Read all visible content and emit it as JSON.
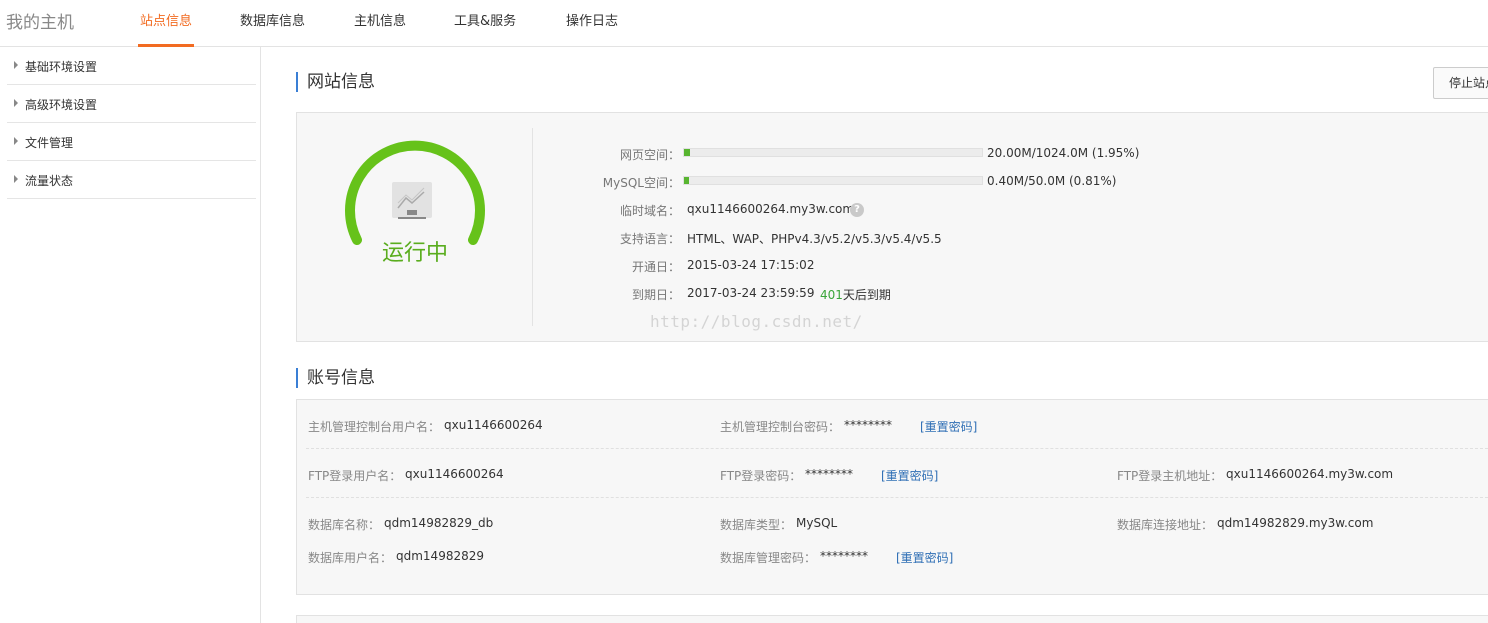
{
  "header": {
    "brand": "我的主机",
    "tabs": [
      {
        "label": "站点信息",
        "active": true
      },
      {
        "label": "数据库信息",
        "active": false
      },
      {
        "label": "主机信息",
        "active": false
      },
      {
        "label": "工具&服务",
        "active": false
      },
      {
        "label": "操作日志",
        "active": false
      }
    ]
  },
  "sidebar": {
    "items": [
      {
        "label": "基础环境设置"
      },
      {
        "label": "高级环境设置"
      },
      {
        "label": "文件管理"
      },
      {
        "label": "流量状态"
      }
    ]
  },
  "site_info": {
    "title": "网站信息",
    "stop_button": "停止站点",
    "status": "运行中",
    "web_space": {
      "label": "网页空间：",
      "value": "20.00M/1024.0M (1.95%)",
      "percent": 1.95
    },
    "mysql_space": {
      "label": "MySQL空间：",
      "value": "0.40M/50.0M (0.81%)",
      "percent": 0.81
    },
    "temp_domain": {
      "label": "临时域名：",
      "value": "qxu1146600264.my3w.com"
    },
    "languages": {
      "label": "支持语言：",
      "value": "HTML、WAP、PHPv4.3/v5.2/v5.3/v5.4/v5.5"
    },
    "open_date": {
      "label": "开通日：",
      "value": "2015-03-24 17:15:02"
    },
    "expire_date": {
      "label": "到期日：",
      "value": "2017-03-24 23:59:59",
      "days": "401",
      "days_suffix": "天后到期"
    },
    "watermark": "http://blog.csdn.net/"
  },
  "account_info": {
    "title": "账号信息",
    "reset_label": "[重置密码]",
    "console_user": {
      "label": "主机管理控制台用户名：",
      "value": "qxu1146600264"
    },
    "console_pwd": {
      "label": "主机管理控制台密码：",
      "value": "********"
    },
    "ftp_user": {
      "label": "FTP登录用户名：",
      "value": "qxu1146600264"
    },
    "ftp_pwd": {
      "label": "FTP登录密码：",
      "value": "********"
    },
    "ftp_host": {
      "label": "FTP登录主机地址：",
      "value": "qxu1146600264.my3w.com"
    },
    "db_name": {
      "label": "数据库名称：",
      "value": "qdm14982829_db"
    },
    "db_type": {
      "label": "数据库类型：",
      "value": "MySQL"
    },
    "db_host": {
      "label": "数据库连接地址：",
      "value": "qdm14982829.my3w.com"
    },
    "db_user": {
      "label": "数据库用户名：",
      "value": "qdm14982829"
    },
    "db_pwd": {
      "label": "数据库管理密码：",
      "value": "********"
    }
  },
  "colors": {
    "accent": "#f26b21",
    "status_green": "#5aad1e",
    "link_blue": "#2f6fb5"
  }
}
